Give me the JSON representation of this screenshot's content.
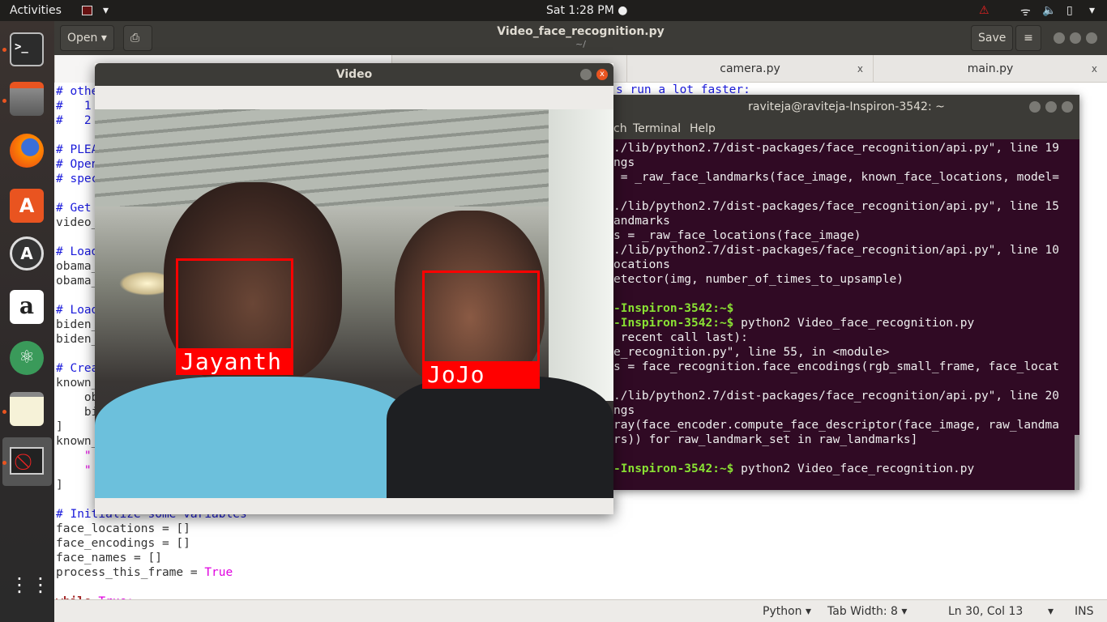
{
  "topbar": {
    "activities": "Activities",
    "clock": "Sat  1:28 PM ●",
    "app_menu_arrow": "▾",
    "system_arrow": "▾"
  },
  "dock": {
    "items": [
      "terminal",
      "files",
      "firefox",
      "software-center",
      "software-updater",
      "amazon",
      "atom",
      "text-editor",
      "system-monitor"
    ],
    "apps_grid": "show-applications"
  },
  "gedit": {
    "open_label": "Open ▾",
    "title": "Video_face_recognition.py",
    "subtitle": "~/",
    "save_label": "Save",
    "menu_icon": "≡",
    "tabs": [
      {
        "label": "camera.py",
        "close": "x"
      },
      {
        "label": "main.py",
        "close": "x"
      }
    ],
    "lines": [
      {
        "t": "# othe",
        "c": "cm"
      },
      {
        "t": "#   1",
        "c": "cm"
      },
      {
        "t": "#   2",
        "c": "cm"
      },
      {
        "t": "",
        "c": ""
      },
      {
        "t": "# PLEA",
        "c": "cm"
      },
      {
        "t": "# Open",
        "c": "cm"
      },
      {
        "t": "# spec",
        "c": "cm"
      },
      {
        "t": "",
        "c": ""
      },
      {
        "t": "# Get",
        "c": "cm"
      },
      {
        "t": "video_",
        "c": ""
      },
      {
        "t": "",
        "c": ""
      },
      {
        "t": "# Load",
        "c": "cm"
      },
      {
        "t": "obama_",
        "c": ""
      },
      {
        "t": "obama_",
        "c": ""
      },
      {
        "t": "",
        "c": ""
      },
      {
        "t": "# Load",
        "c": "cm"
      },
      {
        "t": "biden_",
        "c": ""
      },
      {
        "t": "biden_",
        "c": ""
      },
      {
        "t": "",
        "c": ""
      },
      {
        "t": "# Crea",
        "c": "cm"
      },
      {
        "t": "known_",
        "c": ""
      },
      {
        "t": "    ob",
        "c": ""
      },
      {
        "t": "    bi",
        "c": ""
      },
      {
        "t": "]",
        "c": ""
      },
      {
        "t": "known_",
        "c": ""
      },
      {
        "t": "    \"",
        "c": "cst"
      },
      {
        "t": "    \"",
        "c": "cst"
      },
      {
        "t": "]",
        "c": ""
      },
      {
        "t": "",
        "c": ""
      },
      {
        "t": "# Initialize some variables",
        "c": "cm"
      },
      {
        "t": "face_locations = []",
        "c": ""
      },
      {
        "t": "face_encodings = []",
        "c": ""
      },
      {
        "t": "face_names = []",
        "c": ""
      },
      {
        "t": "process_this_frame = ",
        "c": "",
        "k": "True"
      },
      {
        "t": "",
        "c": ""
      },
      {
        "t": "while ",
        "c": "kw",
        "k": "True:"
      }
    ],
    "line1_tail": "s run a lot faster:",
    "status": {
      "language": "Python ▾",
      "tab_width": "Tab Width: 8 ▾",
      "position": "Ln 30, Col 13",
      "pos_arrow": "▾",
      "mode": "INS"
    }
  },
  "terminal": {
    "title": "raviteja@raviteja-Inspiron-3542: ~",
    "menu": [
      "ch",
      "Terminal",
      "Help"
    ],
    "lines": [
      {
        "t": "./lib/python2.7/dist-packages/face_recognition/api.py\", line 19"
      },
      {
        "t": "ngs"
      },
      {
        "t": " = _raw_face_landmarks(face_image, known_face_locations, model="
      },
      {
        "t": ""
      },
      {
        "t": "./lib/python2.7/dist-packages/face_recognition/api.py\", line 15"
      },
      {
        "t": "andmarks"
      },
      {
        "t": "s = _raw_face_locations(face_image)"
      },
      {
        "t": "./lib/python2.7/dist-packages/face_recognition/api.py\", line 10"
      },
      {
        "t": "ocations"
      },
      {
        "t": "etector(img, number_of_times_to_upsample)"
      },
      {
        "t": ""
      },
      {
        "p": "-Inspiron-3542:~$",
        "t": ""
      },
      {
        "p": "-Inspiron-3542:~$",
        "t": " python2 Video_face_recognition.py"
      },
      {
        "t": " recent call last):"
      },
      {
        "t": "e_recognition.py\", line 55, in <module>"
      },
      {
        "t": "s = face_recognition.face_encodings(rgb_small_frame, face_locat"
      },
      {
        "t": ""
      },
      {
        "t": "./lib/python2.7/dist-packages/face_recognition/api.py\", line 20"
      },
      {
        "t": "ngs"
      },
      {
        "t": "ray(face_encoder.compute_face_descriptor(face_image, raw_landma"
      },
      {
        "t": "rs)) for raw_landmark_set in raw_landmarks]"
      },
      {
        "t": ""
      },
      {
        "p": "-Inspiron-3542:~$",
        "t": " python2 Video_face_recognition.py"
      }
    ]
  },
  "video": {
    "title": "Video",
    "close": "x",
    "faces": [
      {
        "name": "Jayanth"
      },
      {
        "name": "JoJo"
      }
    ]
  },
  "colors": {
    "accent": "#e95420",
    "box": "#ff0000",
    "terminal_bg": "#300a24",
    "prompt": "#8ae234"
  }
}
